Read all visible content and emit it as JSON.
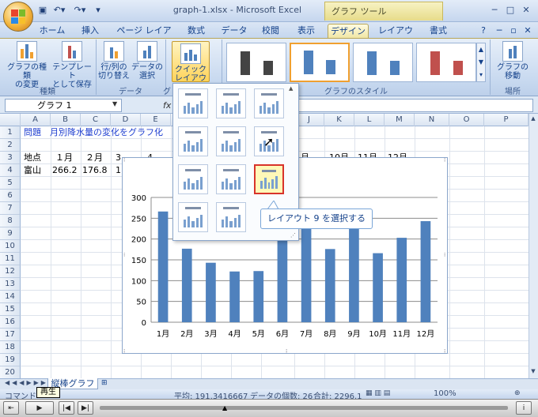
{
  "window": {
    "title": "graph-1.xlsx - Microsoft Excel",
    "context_tools": "グラフ ツール"
  },
  "tabs": [
    "ホーム",
    "挿入",
    "ページ レイアウト",
    "数式",
    "データ",
    "校閲",
    "表示",
    "デザイン",
    "レイアウト",
    "書式"
  ],
  "active_tab": "デザイン",
  "ribbon": {
    "btn_change_type": "グラフの種類\nの変更",
    "btn_save_template": "テンプレート\nとして保存",
    "btn_switch_rowcol": "行/列の\n切り替え",
    "btn_select_data": "データの\n選択",
    "btn_quick_layout": "クイック\nレイアウト",
    "btn_move_chart": "グラフの\n移動",
    "group_type": "種類",
    "group_data": "データ",
    "group_styles": "グラフのスタイル",
    "group_location": "場所",
    "group_layout_fragment": "グ"
  },
  "formula_bar": {
    "name_box": "グラフ 1",
    "fx": "fx"
  },
  "columns": [
    "A",
    "B",
    "C",
    "D",
    "E",
    "",
    "",
    "",
    "",
    "J",
    "K",
    "L",
    "M",
    "N",
    "O",
    "P"
  ],
  "rows": [
    "1",
    "2",
    "3",
    "4",
    "5",
    "6",
    "7",
    "8",
    "9",
    "10",
    "11",
    "12",
    "13",
    "14",
    "15",
    "16",
    "17",
    "18",
    "19",
    "20"
  ],
  "cells": {
    "a1": "問題　月別降水量の変化をグラフ化",
    "a3": "地点",
    "b3": "１月",
    "c3": "２月",
    "d3": "3",
    "e3": "4",
    "j3": "月",
    "k3": "10月",
    "l3": "11月",
    "m3": "12月",
    "a4": "富山",
    "b4": "266.2",
    "c4": "176.8",
    "d4": "1"
  },
  "callout": "レイアウト 9 を選択する",
  "sheet_tab": "縦棒グラフ",
  "status": {
    "mode": "コマンド",
    "average": "平均: 191.3416667",
    "count": "データの個数: 26",
    "sum": "合計: 2296.1",
    "zoom": "100%"
  },
  "player": {
    "tooltip": "再生"
  },
  "chart_data": {
    "type": "bar",
    "categories": [
      "1月",
      "2月",
      "3月",
      "4月",
      "5月",
      "6月",
      "7月",
      "8月",
      "9月",
      "10月",
      "11月",
      "12月"
    ],
    "values": [
      266.2,
      176.8,
      143,
      122,
      123,
      200,
      230,
      176,
      230,
      166,
      203,
      243
    ],
    "ylim": [
      0,
      300
    ],
    "yticks": [
      0,
      50,
      100,
      150,
      200,
      250,
      300
    ],
    "bar_color": "#4f81bd",
    "grid": true
  },
  "colors": {
    "accent": "#4f81bd",
    "selection": "#d8332a"
  }
}
